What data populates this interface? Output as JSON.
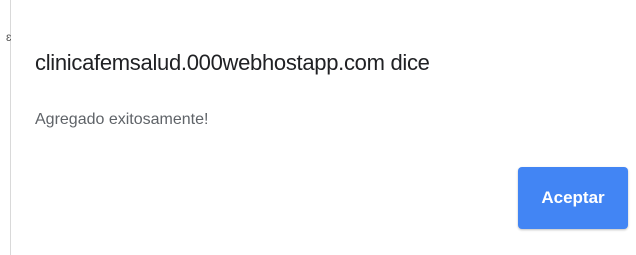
{
  "edge": {
    "mark": "ɛ"
  },
  "dialog": {
    "title": "clinicafemsalud.000webhostapp.com dice",
    "message": "Agregado exitosamente!",
    "accept_label": "Aceptar"
  },
  "colors": {
    "accent": "#4285f4",
    "title_text": "#202124",
    "message_text": "#5f6368"
  }
}
